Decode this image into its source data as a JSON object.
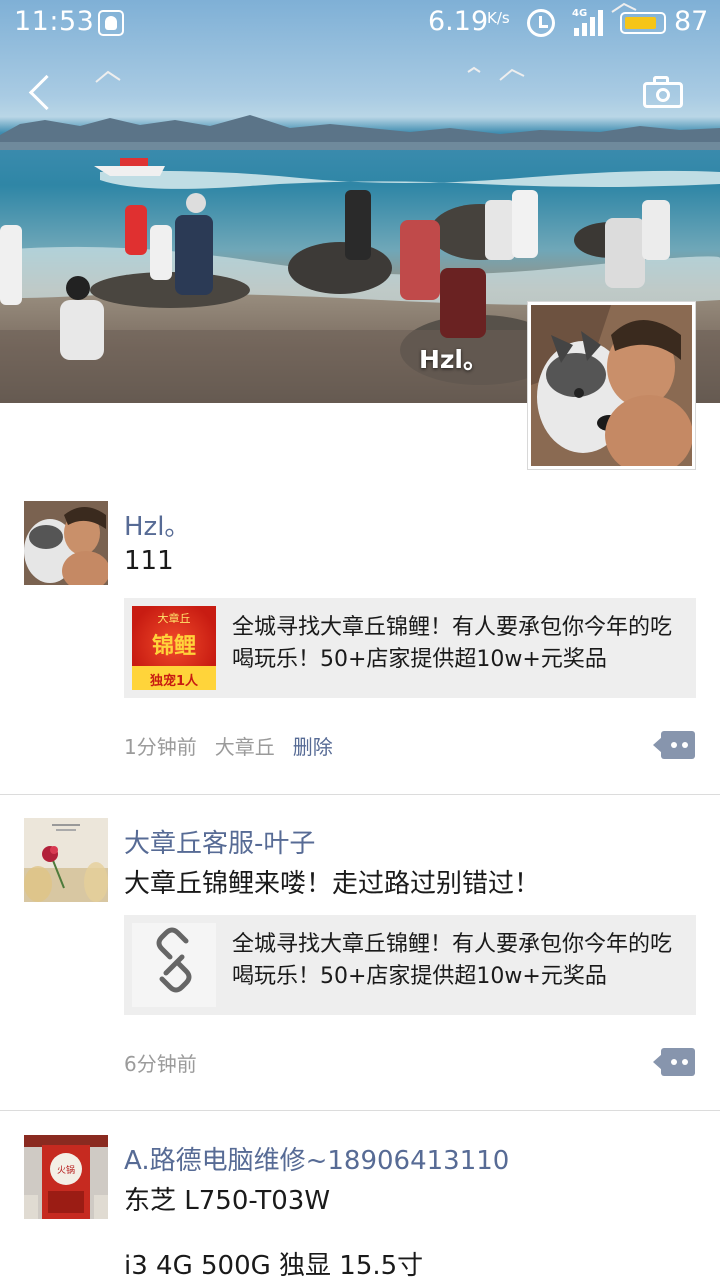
{
  "status_bar": {
    "time": "11:53",
    "network_speed": "6.19",
    "network_speed_unit": "K/s",
    "network_type": "4G",
    "battery": "87",
    "battery_level": 0.87,
    "accent_battery": "#f5c518"
  },
  "header": {
    "back_icon": "back-arrow-icon",
    "camera_icon": "camera-icon",
    "cover_name": "Hzl。"
  },
  "posts": [
    {
      "nickname": "Hzl。",
      "text": "111",
      "link_title": "全城寻找大章丘锦鲤！有人要承包你今年的吃喝玩乐！50+店家提供超10w+元奖品",
      "thumb": {
        "top": "大章丘",
        "main": "锦鲤",
        "bottom": "独宠1人"
      },
      "time": "1分钟前",
      "location": "大章丘",
      "delete_label": "删除"
    },
    {
      "nickname": "大章丘客服-叶子",
      "text": "大章丘锦鲤来喽！走过路过别错过！",
      "link_title": "全城寻找大章丘锦鲤！有人要承包你今年的吃喝玩乐！50+店家提供超10w+元奖品",
      "thumb_icon": "link-icon",
      "time": "6分钟前"
    },
    {
      "nickname": "A.路德电脑维修~18906413110",
      "text_line1": "东芝 L750-T03W",
      "text_line2": "i3 4G 500G 独显 15.5寸",
      "thumb": {
        "sign": "火锅"
      }
    }
  ],
  "colors": {
    "nickname": "#576b95",
    "meta": "#9b9b9b",
    "card_bg": "#eeeeee",
    "more_button": "#8795ad"
  }
}
